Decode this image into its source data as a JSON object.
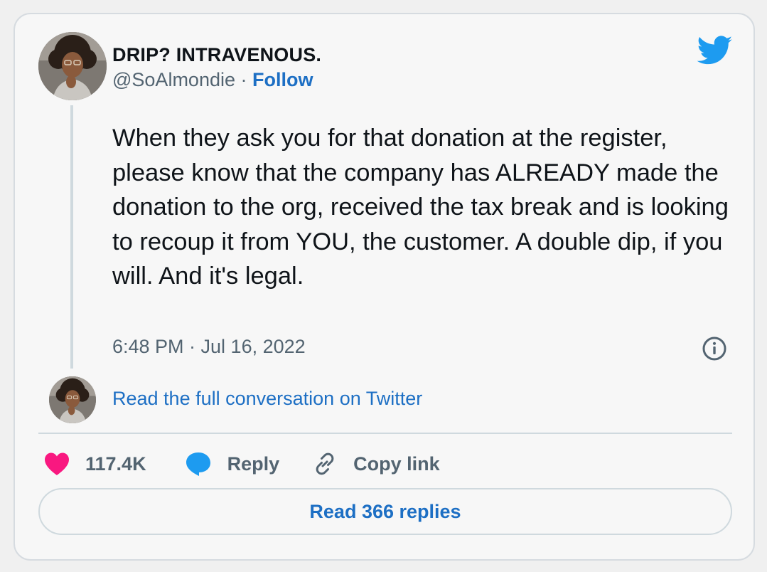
{
  "author": {
    "display_name": "DRIP? INTRAVENOUS.",
    "handle": "@SoAlmondie",
    "separator": " · ",
    "follow_label": "Follow"
  },
  "tweet": {
    "text": "When they ask you for that donation at the register, please know that the company has ALREADY made the donation to the org, received the tax break and is looking to recoup it from YOU, the customer. A double dip, if you will. And it's legal.",
    "timestamp": "6:48 PM · Jul 16, 2022"
  },
  "conversation_link": "Read the full conversation on Twitter",
  "actions": {
    "like_count": "117.4K",
    "reply_label": "Reply",
    "copy_link_label": "Copy link"
  },
  "read_replies_label": "Read 366 replies",
  "icons": {
    "brand": "twitter-bird-icon",
    "like": "heart-icon",
    "reply": "speech-bubble-icon",
    "copy": "link-icon",
    "info": "info-icon"
  },
  "colors": {
    "accent_blue": "#1d6fc4",
    "twitter_blue": "#1d9bf0",
    "like_pink": "#f91880",
    "muted_text": "#536471",
    "border": "#cfd9de"
  }
}
